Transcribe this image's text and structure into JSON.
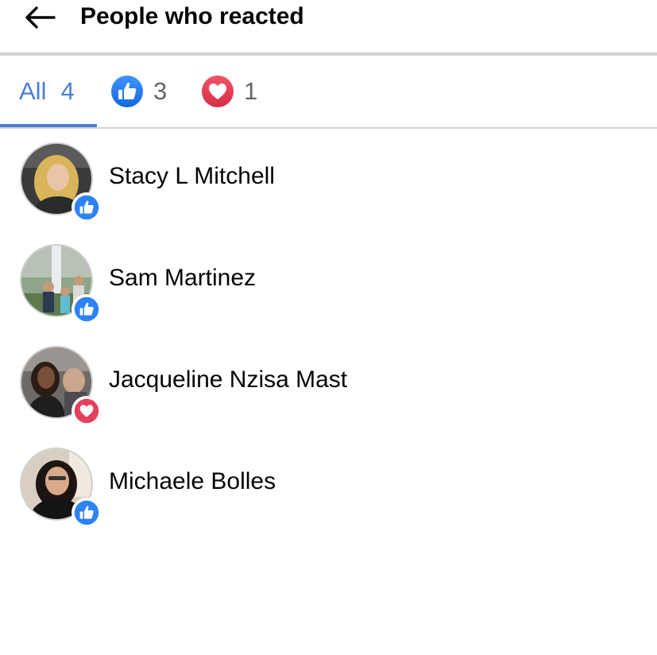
{
  "header": {
    "title": "People who reacted"
  },
  "tabs": {
    "all": {
      "label": "All",
      "count": "4"
    },
    "like": {
      "icon": "like-icon",
      "count": "3"
    },
    "love": {
      "icon": "love-icon",
      "count": "1"
    }
  },
  "people": [
    {
      "name": "Stacy L Mitchell",
      "reaction": "like"
    },
    {
      "name": "Sam Martinez",
      "reaction": "like"
    },
    {
      "name": "Jacqueline Nzisa Mast",
      "reaction": "love"
    },
    {
      "name": "Michaele Bolles",
      "reaction": "like"
    }
  ],
  "colors": {
    "accent": "#4a7fd6",
    "like": "#1877f2",
    "love": "#e4405f"
  }
}
